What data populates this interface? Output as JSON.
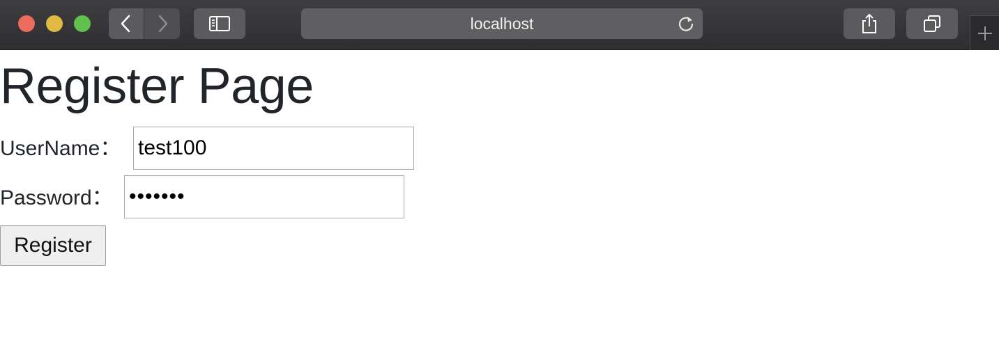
{
  "browser": {
    "address": "localhost",
    "icons": {
      "back": "chevron-left-icon",
      "forward": "chevron-right-icon",
      "sidebar": "sidebar-icon",
      "reload": "reload-icon",
      "share": "share-icon",
      "tabs": "tabs-icon",
      "new_tab": "plus-icon"
    }
  },
  "page": {
    "title": "Register Page",
    "username_label": "UserName：",
    "username_value": "test100",
    "password_label": "Password：",
    "password_value": "•••••••",
    "register_button": "Register"
  },
  "colors": {
    "toolbar": "#333335",
    "close": "#ec6a5e",
    "minimize": "#e0b941",
    "maximize": "#62c04f"
  }
}
